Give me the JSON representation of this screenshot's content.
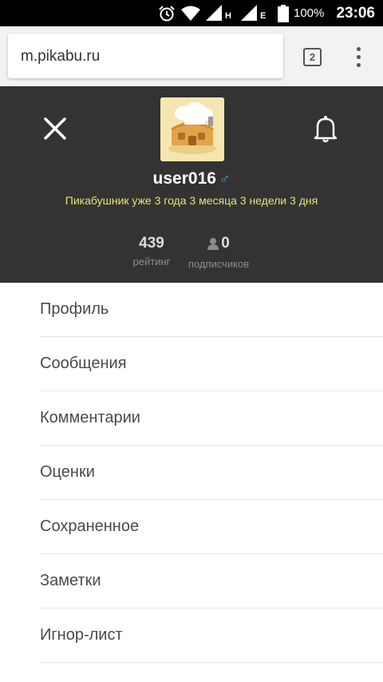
{
  "status_bar": {
    "battery": "100%",
    "time": "23:06",
    "network_letter_1": "H",
    "network_letter_2": "E",
    "icons": [
      "alarm-icon",
      "wifi-icon",
      "signal-icon",
      "signal-icon",
      "battery-icon"
    ]
  },
  "browser": {
    "url": "m.pikabu.ru",
    "tab_count": "2"
  },
  "profile": {
    "username": "user016",
    "gender_symbol": "♂",
    "tagline": "Пикабушник уже 3 года 3 месяца 3 недели 3 дня",
    "rating_value": "439",
    "rating_label": "рейтинг",
    "subscribers_value": "0",
    "subscribers_label": "подписчиков"
  },
  "menu": {
    "items": [
      {
        "label": "Профиль"
      },
      {
        "label": "Сообщения"
      },
      {
        "label": "Комментарии"
      },
      {
        "label": "Оценки"
      },
      {
        "label": "Сохраненное"
      },
      {
        "label": "Заметки"
      },
      {
        "label": "Игнор-лист"
      }
    ]
  },
  "colors": {
    "header_bg": "#333333",
    "tagline": "#e8e07a",
    "gender": "#4a9fd6",
    "menu_text": "#4a4a4a"
  }
}
